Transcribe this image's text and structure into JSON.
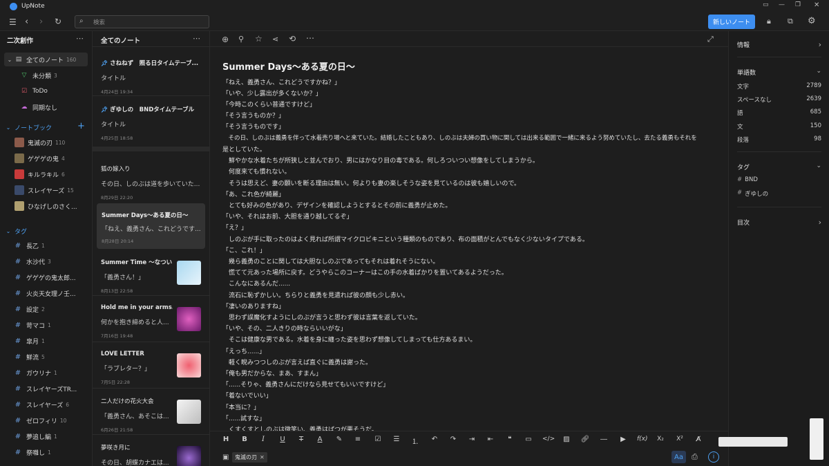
{
  "app": {
    "title": "UpNote"
  },
  "toolbar": {
    "search_placeholder": "検索",
    "new_note_label": "新しいノート"
  },
  "sidebar": {
    "header": "二次創作",
    "all_notes": {
      "label": "全てのノート",
      "count": "160"
    },
    "items": [
      {
        "label": "未分類",
        "count": "3",
        "icon": "filter-icon"
      },
      {
        "label": "ToDo",
        "count": "",
        "icon": "checkbox-icon"
      },
      {
        "label": "同期なし",
        "count": "",
        "icon": "cloud-off-icon"
      }
    ],
    "notebooks_label": "ノートブック",
    "notebooks": [
      {
        "label": "鬼滅の刃",
        "count": "110",
        "color": "#8b5a4a"
      },
      {
        "label": "ゲゲゲの鬼",
        "count": "4",
        "color": "#7a6a4a"
      },
      {
        "label": "キルラキル",
        "count": "6",
        "color": "#c83a3a"
      },
      {
        "label": "スレイヤーズ",
        "count": "15",
        "color": "#3a4a6a"
      },
      {
        "label": "ひなげしのさく...",
        "count": "",
        "color": "#b0a070"
      }
    ],
    "tags_label": "タグ",
    "tags": [
      {
        "label": "長乙",
        "count": "1"
      },
      {
        "label": "水沙代",
        "count": "3"
      },
      {
        "label": "ゲゲゲの鬼太郎...",
        "count": ""
      },
      {
        "label": "火炎天女理ノ壬...",
        "count": ""
      },
      {
        "label": "設定",
        "count": "2"
      },
      {
        "label": "苛マコ",
        "count": "1"
      },
      {
        "label": "皐月",
        "count": "1"
      },
      {
        "label": "鮮流",
        "count": "5"
      },
      {
        "label": "ガウリナ",
        "count": "1"
      },
      {
        "label": "スレイヤーズTR...",
        "count": ""
      },
      {
        "label": "スレイヤーズ",
        "count": "6"
      },
      {
        "label": "ゼロフィリ",
        "count": "10"
      },
      {
        "label": "夢追し編",
        "count": "1"
      },
      {
        "label": "祭囃し",
        "count": "1"
      }
    ]
  },
  "notelist": {
    "header": "全てのノート",
    "pinned": [
      {
        "title": "さねねず　照る日タイムテーブ...",
        "snippet": "タイトル",
        "date": "4月24日 19:34"
      },
      {
        "title": "ぎゆしの　BNDタイムテーブル",
        "snippet": "タイトル",
        "date": "4月25日 18:58"
      }
    ],
    "notes": [
      {
        "title": "狐の嫁入り",
        "snippet": "その日、しのぶは道を歩いていた...",
        "date": "8月29日 22:20"
      },
      {
        "title": "Summer Days〜ある夏の日〜",
        "snippet": "「ねえ、義勇さん、これどうです...",
        "date": "8月28日 20:14"
      },
      {
        "title": "Summer Time 〜なつい...",
        "snippet": "「義勇さん！」",
        "date": "8月13日 22:58"
      },
      {
        "title": "Hold me in your arms...",
        "snippet": "何かを抱き締めると人...",
        "date": "7月16日 19:48"
      },
      {
        "title": "LOVE LETTER",
        "snippet": "「ラブレター？」",
        "date": "7月5日 22:28"
      },
      {
        "title": "二人だけの花火大会",
        "snippet": "「義勇さん、あそこは...",
        "date": "6月26日 21:58"
      },
      {
        "title": "夢咲き月に",
        "snippet": "その日、胡蝶カナエは...",
        "date": ""
      }
    ]
  },
  "editor": {
    "title": "Summer Days〜ある夏の日〜",
    "lines": [
      "「ねえ、義勇さん、これどうですかね？」",
      "「いや、少し露出が多くないか？」",
      "「今時このくらい普通ですけど」",
      "「そう言うものか？」",
      "「そう言うものです」",
      "　その日、しのぶは義勇を伴って水着売り場へと来ていた。結婚したこともあり、しのぶは夫婦の買い物に関しては出来る範囲で一緒に来るよう努めていたし、去たる義勇もそれを",
      "是としていた。",
      "　鮮やかな水着たちが所狭しと並んでおり、男にはかなり目の毒である。何しろついつい想像をしてしまうから。",
      "　何度来ても慣れない。",
      "　そうは思えど、妻の願いを断る理由は無い。何よりも妻の楽しそうな姿を見ているのは彼も嬉しいので。",
      "「あ、これ色が綺麗」",
      "　とても好みの色があり、デザインを確認しようとするとその前に義勇が止めた。",
      "「いや、それはお前、大胆を通り越してるぞ」",
      "「え？」",
      "　しのぶが手に取ったのはよく見れば所謂マイクロビキニという種類のものであり、布の面積がとんでもなく少ないタイプである。",
      "「こ、これ！」",
      "　幾ら義勇のことに関しては大胆なしのぶであってもそれは着れそうにない。",
      "　慌てて元あった場所に戻す。どうやらこのコーナーはこの手の水着ばかりを置いてあるようだった。",
      "　こんなにあるんだ......",
      "　流石に恥ずかしい。ちらりと義勇を見遣れば彼の顔も少し赤い。",
      "「凄いのありますね」",
      "　思わず誤魔化すようにしのぶが言うと思わず彼は言葉を返していた。",
      "「いや、その、二人きりの時ならいいがな」",
      "　そこは健康な男である。水着を身に纏った姿を思わず想像してしまっても仕方あるまい。",
      "「えっち......」",
      "　軽く睨みつつしのぶが言えば直ぐに義勇は謝った。",
      "「俺も男だからな、まあ、すまん」",
      "「......そりゃ、義勇さんにだけなら見せてもいいですけど」",
      "「着ないでいい」",
      "「本当に？」",
      "「......試すな」",
      "　くすくすとしのぶは微笑い、義勇はばつが悪そうだ。"
    ],
    "notebook_chip": "鬼滅の刃",
    "aa_label": "Aa"
  },
  "info": {
    "header": "情報",
    "wordcount_label": "単語数",
    "stats": [
      {
        "label": "文字",
        "value": "2789"
      },
      {
        "label": "スペースなし",
        "value": "2639"
      },
      {
        "label": "語",
        "value": "685"
      },
      {
        "label": "文",
        "value": "150"
      },
      {
        "label": "段落",
        "value": "98"
      }
    ],
    "tags_label": "タグ",
    "tags": [
      "BND",
      "ぎゆしの"
    ],
    "toc_label": "目次"
  },
  "colors": {
    "accent": "#3d8ef0",
    "tag_hash": "#6a9ad8"
  }
}
